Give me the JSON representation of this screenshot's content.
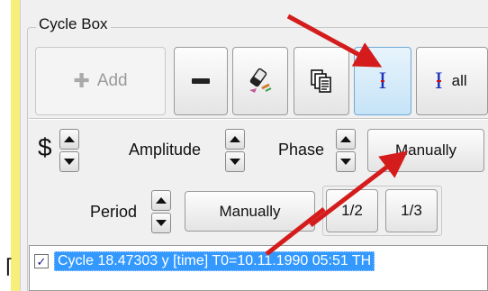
{
  "group": {
    "title": "Cycle Box"
  },
  "toolbar": {
    "add_label": "Add",
    "add_icon": "plus-icon",
    "remove_icon": "minus-icon",
    "eraser_icon": "eraser-icon",
    "copy_icon": "copy-pages-icon",
    "cursor_icon": "text-cursor-icon",
    "all_icon": "text-cursor-icon",
    "all_label": "all"
  },
  "params": {
    "dollar_label": "$",
    "amplitude_label": "Amplitude",
    "phase_label": "Phase",
    "phase_button": "Manually",
    "period_label": "Period",
    "period_button": "Manually",
    "half_button": "1/2",
    "third_button": "1/3"
  },
  "list": {
    "items": [
      {
        "checked": true,
        "text": "Cycle 18.47303 y [time] T0=10.11.1990  05:51 TH"
      }
    ]
  },
  "colors": {
    "annotation_arrow": "#d41c1c",
    "selection": "#3399ff",
    "highlight_button": "#c6e3f7",
    "yellow_strip": "#f6f07a"
  }
}
